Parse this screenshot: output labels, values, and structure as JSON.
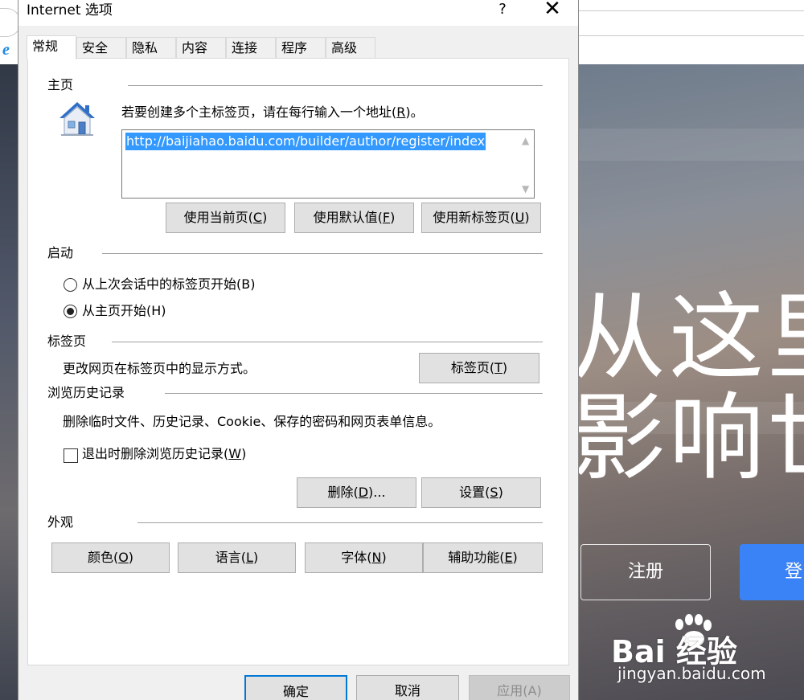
{
  "dialog": {
    "title": "Internet 选项",
    "help_label": "?",
    "close_label": "✕",
    "tabs": [
      {
        "label": "常规",
        "active": true
      },
      {
        "label": "安全",
        "active": false
      },
      {
        "label": "隐私",
        "active": false
      },
      {
        "label": "内容",
        "active": false
      },
      {
        "label": "连接",
        "active": false
      },
      {
        "label": "程序",
        "active": false
      },
      {
        "label": "高级",
        "active": false
      }
    ],
    "homepage": {
      "heading": "主页",
      "description_pre": "若要创建多个主标签页，请在每行输入一个地址(",
      "description_key": "R",
      "description_post": ")。",
      "url": "http://baijiahao.baidu.com/builder/author/register/index",
      "icon": "house-icon",
      "buttons": [
        {
          "pre": "使用当前页(",
          "key": "C",
          "post": ")"
        },
        {
          "pre": "使用默认值(",
          "key": "F",
          "post": ")"
        },
        {
          "pre": "使用新标签页(",
          "key": "U",
          "post": ")"
        }
      ]
    },
    "startup": {
      "heading": "启动",
      "options": [
        {
          "label": "从上次会话中的标签页开始(B)",
          "selected": false
        },
        {
          "label": "从主页开始(H)",
          "selected": true
        }
      ]
    },
    "tabs_section": {
      "heading": "标签页",
      "description": "更改网页在标签页中的显示方式。",
      "button": {
        "pre": "标签页(",
        "key": "T",
        "post": ")"
      }
    },
    "history": {
      "heading": "浏览历史记录",
      "description": "删除临时文件、历史记录、Cookie、保存的密码和网页表单信息。",
      "checkbox": {
        "pre": "退出时删除浏览历史记录(",
        "key": "W",
        "post": ")",
        "checked": false
      },
      "buttons": [
        {
          "pre": "删除(",
          "key": "D",
          "post": ")..."
        },
        {
          "pre": "设置(",
          "key": "S",
          "post": ")"
        }
      ]
    },
    "appearance": {
      "heading": "外观",
      "buttons": [
        {
          "pre": "颜色(",
          "key": "O",
          "post": ")"
        },
        {
          "pre": "语言(",
          "key": "L",
          "post": ")"
        },
        {
          "pre": "字体(",
          "key": "N",
          "post": ")"
        },
        {
          "pre": "辅助功能(",
          "key": "E",
          "post": ")"
        }
      ]
    },
    "footer": {
      "ok": "确定",
      "cancel": "取消",
      "apply": "应用(A)"
    }
  },
  "background_page": {
    "hero_line1": "从这里",
    "hero_line2": "影响世",
    "register_label": "注册",
    "login_label": "登",
    "watermark_brand": "Bai 经验",
    "watermark_url": "jingyan.baidu.com",
    "login_color": "#3a83f7"
  }
}
